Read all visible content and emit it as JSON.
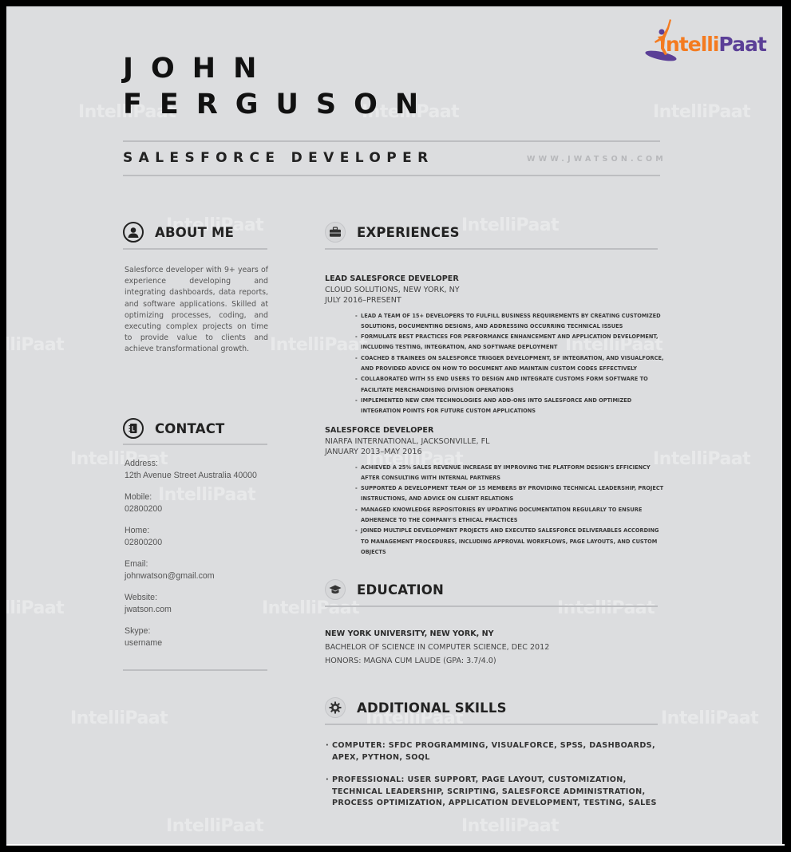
{
  "branding": {
    "logo_part1": "ntelli",
    "logo_part2": "Paat",
    "logo_initial": "I",
    "watermark": "IntelliPaat",
    "colors": {
      "orange": "#f47b20",
      "purple": "#5b3f97"
    }
  },
  "header": {
    "first_name": "JOHN",
    "last_name": "FERGUSON",
    "title": "SALESFORCE DEVELOPER",
    "website": "WWW.JWATSON.COM"
  },
  "about": {
    "heading": "ABOUT ME",
    "icon": "user-circle-icon",
    "text": "Salesforce developer with 9+ years of experience developing and integrating dashboards, data reports, and software applications. Skilled at optimizing processes, coding, and executing complex projects on time to provide value to clients and achieve transformational growth."
  },
  "contact": {
    "heading": "CONTACT",
    "icon": "address-book-icon",
    "items": [
      {
        "label": "Address:",
        "value": "12th Avenue Street Australia 40000"
      },
      {
        "label": "Mobile:",
        "value": "02800200"
      },
      {
        "label": "Home:",
        "value": "02800200"
      },
      {
        "label": "Email:",
        "value": "johnwatson@gmail.com"
      },
      {
        "label": "Website:",
        "value": "jwatson.com"
      },
      {
        "label": "Skype:",
        "value": "username"
      }
    ]
  },
  "experience": {
    "heading": "EXPERIENCES",
    "icon": "briefcase-icon",
    "jobs": [
      {
        "title": "LEAD SALESFORCE DEVELOPER",
        "company": "CLOUD SOLUTIONS, NEW YORK, NY",
        "dates": "JULY 2016–PRESENT",
        "bullets": [
          "LEAD A TEAM OF 15+ DEVELOPERS TO FULFILL BUSINESS REQUIREMENTS BY CREATING CUSTOMIZED SOLUTIONS, DOCUMENTING DESIGNS, AND ADDRESSING OCCURRING TECHNICAL ISSUES",
          "FORMULATE BEST PRACTICES FOR PERFORMANCE ENHANCEMENT AND APPLICATION DEVELOPMENT, INCLUDING TESTING, INTEGRATION, AND SOFTWARE DEPLOYMENT",
          "COACHED 8 TRAINEES ON SALESFORCE TRIGGER DEVELOPMENT, SF INTEGRATION, AND VISUALFORCE, AND PROVIDED ADVICE ON HOW TO DOCUMENT AND MAINTAIN CUSTOM CODES EFFECTIVELY",
          "COLLABORATED WITH 55 END USERS TO DESIGN AND INTEGRATE CUSTOMS FORM SOFTWARE TO FACILITATE MERCHANDISING DIVISION OPERATIONS",
          "IMPLEMENTED NEW CRM TECHNOLOGIES AND ADD-ONS INTO SALESFORCE AND OPTIMIZED INTEGRATION POINTS FOR FUTURE CUSTOM APPLICATIONS"
        ]
      },
      {
        "title": "SALESFORCE DEVELOPER",
        "company": "NIARFA INTERNATIONAL, JACKSONVILLE, FL",
        "dates": "JANUARY 2013–MAY 2016",
        "bullets": [
          "ACHIEVED A 25% SALES REVENUE INCREASE BY IMPROVING THE PLATFORM DESIGN'S EFFICIENCY AFTER CONSULTING WITH INTERNAL PARTNERS",
          "SUPPORTED A DEVELOPMENT TEAM OF 15 MEMBERS BY PROVIDING TECHNICAL LEADERSHIP, PROJECT INSTRUCTIONS, AND ADVICE ON CLIENT RELATIONS",
          "MANAGED KNOWLEDGE REPOSITORIES BY UPDATING DOCUMENTATION REGULARLY TO ENSURE ADHERENCE TO THE COMPANY'S ETHICAL PRACTICES",
          "JOINED MULTIPLE DEVELOPMENT PROJECTS AND EXECUTED SALESFORCE DELIVERABLES ACCORDING TO MANAGEMENT PROCEDURES, INCLUDING APPROVAL WORKFLOWS, PAGE LAYOUTS, AND CUSTOM OBJECTS"
        ]
      }
    ]
  },
  "education": {
    "heading": "EDUCATION",
    "icon": "graduation-cap-icon",
    "school": "NEW YORK UNIVERSITY, NEW YORK, NY",
    "degree": "BACHELOR OF SCIENCE IN COMPUTER SCIENCE, DEC 2012",
    "honors": "HONORS: MAGNA CUM LAUDE (GPA: 3.7/4.0)"
  },
  "skills": {
    "heading": "ADDITIONAL SKILLS",
    "icon": "gear-icon",
    "items": [
      "COMPUTER: SFDC PROGRAMMING, VISUALFORCE, SPSS, DASHBOARDS, APEX, PYTHON, SOQL",
      "PROFESSIONAL: USER SUPPORT, PAGE LAYOUT, CUSTOMIZATION, TECHNICAL LEADERSHIP, SCRIPTING, SALESFORCE ADMINISTRATION, PROCESS OPTIMIZATION, APPLICATION DEVELOPMENT, TESTING, SALES"
    ]
  }
}
